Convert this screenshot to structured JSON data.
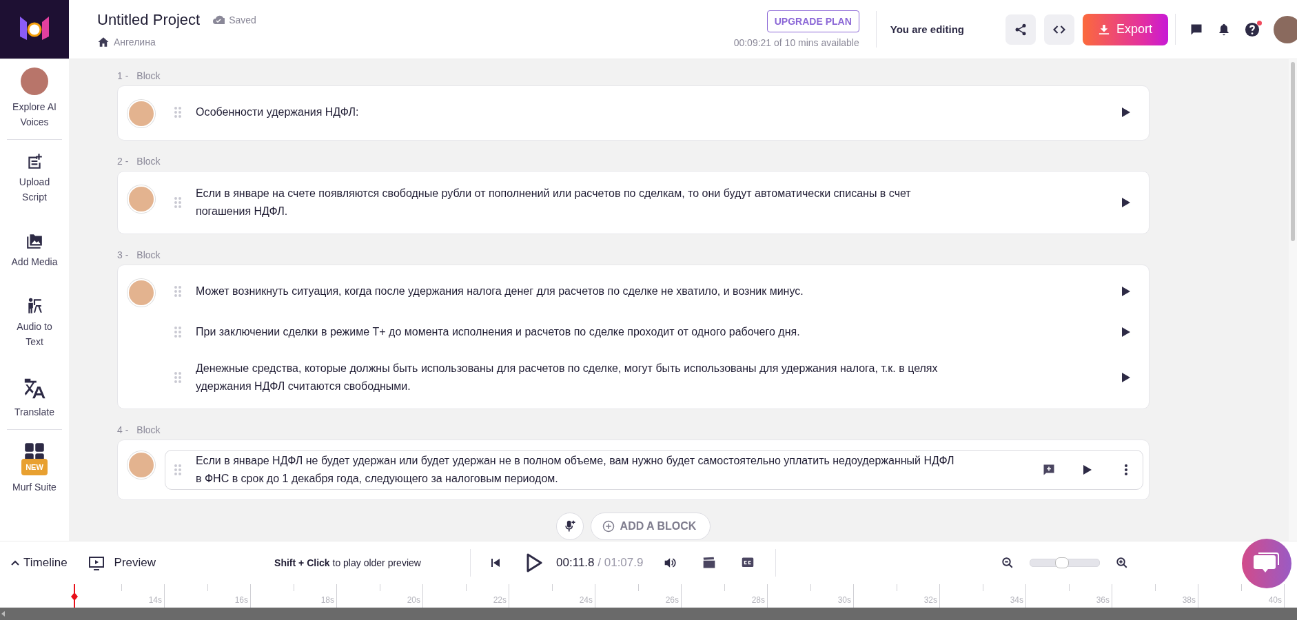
{
  "header": {
    "title": "Untitled Project",
    "save_status": "Saved",
    "workspace": "Ангелина",
    "upgrade_button": "UPGRADE PLAN",
    "usage": "00:09:21 of 10 mins available",
    "editing_status": "You are editing",
    "export_button": "Export",
    "help_has_notification": true
  },
  "sidebar": {
    "groups": [
      [
        {
          "kind": "voices",
          "label": "Explore AI Voices"
        }
      ],
      [
        {
          "kind": "upload",
          "label": "Upload Script"
        },
        {
          "kind": "media",
          "label": "Add Media"
        },
        {
          "kind": "audio",
          "label": "Audio to Text"
        },
        {
          "kind": "translate",
          "label": "Translate"
        }
      ],
      [
        {
          "kind": "suite",
          "label": "Murf Suite",
          "badge": "NEW"
        }
      ]
    ]
  },
  "blocks": [
    {
      "number": "1 -",
      "label": "Block",
      "paragraphs": [
        {
          "text": "Особенности удержания НДФЛ:",
          "hovered": false
        }
      ]
    },
    {
      "number": "2 -",
      "label": "Block",
      "paragraphs": [
        {
          "text": "Если в январе на счете появляются свободные рубли от пополнений или расчетов по сделкам, то они будут автоматически списаны в счет погашения НДФЛ.",
          "hovered": false
        }
      ]
    },
    {
      "number": "3 -",
      "label": "Block",
      "paragraphs": [
        {
          "text": "Может возникнуть ситуация, когда после удержания налога денег для расчетов по сделке не хватило, и возник минус.",
          "hovered": false
        },
        {
          "text": "При заключении сделки в режиме Т+ до момента исполнения и расчетов по сделке проходит от одного рабочего дня.",
          "hovered": false
        },
        {
          "text": "Денежные средства, которые должны быть использованы для расчетов по сделке, могут быть использованы для удержания налога, т.к. в целях удержания НДФЛ считаются свободными.",
          "hovered": false
        }
      ]
    },
    {
      "number": "4 -",
      "label": "Block",
      "paragraphs": [
        {
          "text": "Если в январе НДФЛ не будет удержан или будет удержан не в полном объеме, вам нужно будет самостоятельно уплатить недоудержанный НДФЛ в ФНС в срок до 1 декабря года, следующего за налоговым периодом.",
          "hovered": true
        }
      ]
    }
  ],
  "add_block_button": "ADD A BLOCK",
  "player": {
    "timeline_toggle": "Timeline",
    "preview": "Preview",
    "hint": "**Shift + Click** to play older preview",
    "current_time": "00:11.8",
    "total_time": "/ 01:07.9",
    "zoom": {
      "level": 0.45
    }
  },
  "timeline": {
    "ticks": [
      "14s",
      "16s",
      "18s",
      "20s",
      "22s",
      "24s",
      "26s",
      "28s",
      "30s",
      "32s",
      "34s",
      "36s",
      "38s",
      "40s"
    ]
  }
}
